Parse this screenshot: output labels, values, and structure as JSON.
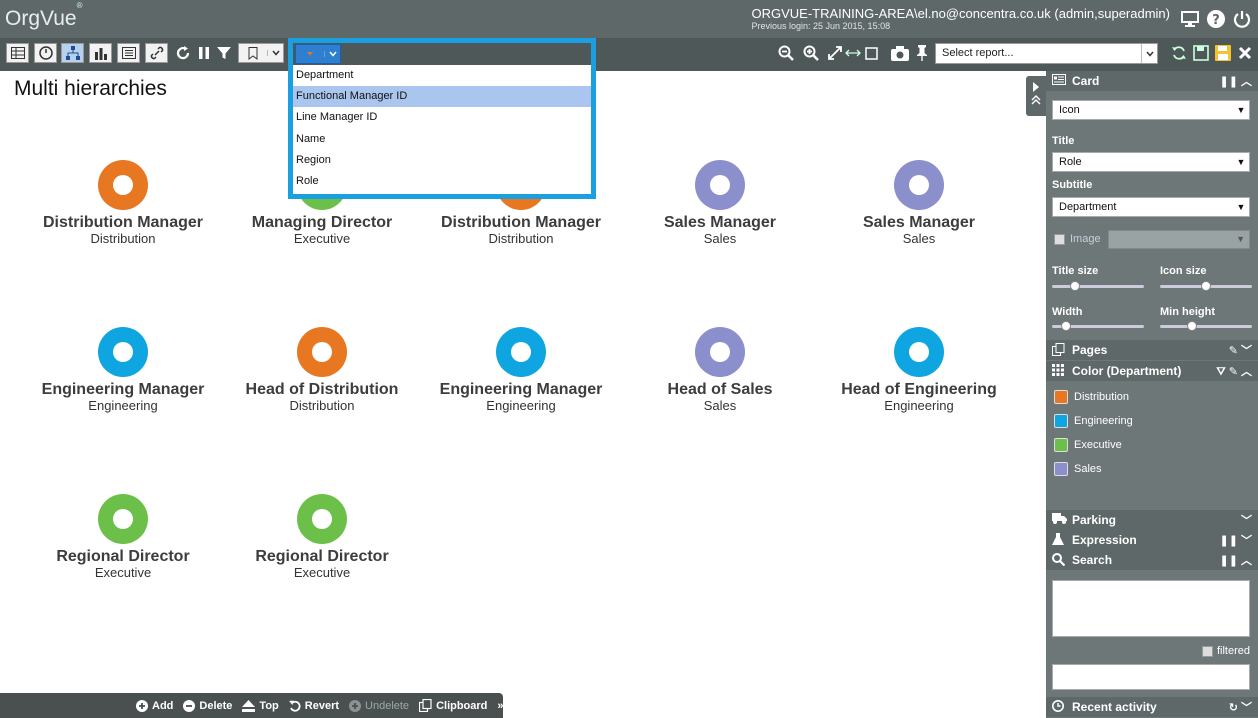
{
  "app": {
    "logo": "OrgVue",
    "logo_mark": "®",
    "account": "ORGVUE-TRAINING-AREA\\el.no@concentra.co.uk (admin,superadmin)",
    "previous_login": "Previous login: 25 Jun 2015, 15:08"
  },
  "toolbar": {
    "report_placeholder": "Select report..."
  },
  "dropdown": {
    "items": [
      "Department",
      "Functional Manager ID",
      "Line Manager ID",
      "Name",
      "Region",
      "Role"
    ],
    "selected": "Functional Manager ID"
  },
  "page": {
    "title": "Multi hierarchies"
  },
  "cards": [
    {
      "title": "Distribution Manager",
      "subtitle": "Distribution",
      "color": "#e87722"
    },
    {
      "title": "Managing Director",
      "subtitle": "Executive",
      "color": "#6cc04a"
    },
    {
      "title": "Distribution Manager",
      "subtitle": "Distribution",
      "color": "#e87722"
    },
    {
      "title": "Sales Manager",
      "subtitle": "Sales",
      "color": "#8b8fcc"
    },
    {
      "title": "Sales Manager",
      "subtitle": "Sales",
      "color": "#8b8fcc"
    },
    {
      "title": "Engineering Manager",
      "subtitle": "Engineering",
      "color": "#0ea5e0"
    },
    {
      "title": "Head of Distribution",
      "subtitle": "Distribution",
      "color": "#e87722"
    },
    {
      "title": "Engineering Manager",
      "subtitle": "Engineering",
      "color": "#0ea5e0"
    },
    {
      "title": "Head of Sales",
      "subtitle": "Sales",
      "color": "#8b8fcc"
    },
    {
      "title": "Head of Engineering",
      "subtitle": "Engineering",
      "color": "#0ea5e0"
    },
    {
      "title": "Regional Director",
      "subtitle": "Executive",
      "color": "#6cc04a"
    },
    {
      "title": "Regional Director",
      "subtitle": "Executive",
      "color": "#6cc04a"
    }
  ],
  "bottom": {
    "add": "Add",
    "delete": "Delete",
    "top": "Top",
    "revert": "Revert",
    "undelete": "Undelete",
    "clipboard": "Clipboard",
    "more": "»"
  },
  "sidebar": {
    "card_label": "Card",
    "card_type": "Icon",
    "title_label": "Title",
    "title_value": "Role",
    "subtitle_label": "Subtitle",
    "subtitle_value": "Department",
    "image_label": "Image",
    "title_size_label": "Title size",
    "icon_size_label": "Icon size",
    "width_label": "Width",
    "min_height_label": "Min height",
    "title_size": 0.25,
    "icon_size": 0.5,
    "width": 0.15,
    "min_height": 0.35,
    "pages_label": "Pages",
    "color_label": "Color (Department)",
    "legend": [
      {
        "name": "Distribution",
        "color": "#e87722"
      },
      {
        "name": "Engineering",
        "color": "#0ea5e0"
      },
      {
        "name": "Executive",
        "color": "#6cc04a"
      },
      {
        "name": "Sales",
        "color": "#8b8fcc"
      }
    ],
    "parking_label": "Parking",
    "expression_label": "Expression",
    "search_label": "Search",
    "filtered_label": "filtered",
    "recent_label": "Recent activity"
  }
}
